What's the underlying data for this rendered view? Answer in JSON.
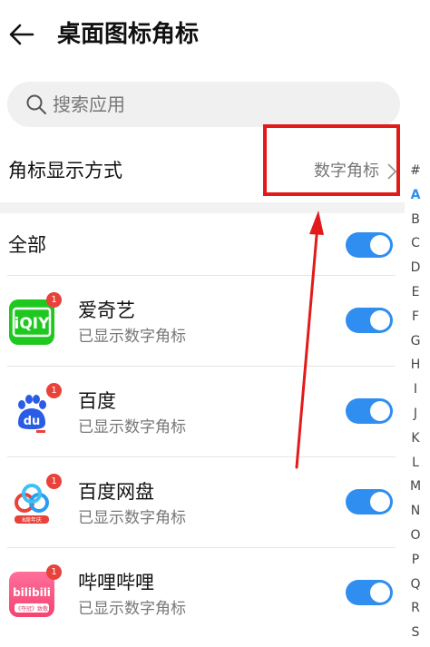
{
  "header": {
    "title": "桌面图标角标"
  },
  "search": {
    "placeholder": "搜索应用"
  },
  "badge_mode": {
    "label": "角标显示方式",
    "value": "数字角标"
  },
  "all": {
    "label": "全部",
    "enabled": true
  },
  "apps": [
    {
      "name": "爱奇艺",
      "status": "已显示数字角标",
      "badge": "1",
      "enabled": true,
      "icon": "iqiyi-icon"
    },
    {
      "name": "百度",
      "status": "已显示数字角标",
      "badge": "1",
      "enabled": true,
      "icon": "baidu-icon"
    },
    {
      "name": "百度网盘",
      "status": "已显示数字角标",
      "badge": "1",
      "enabled": true,
      "icon": "baidu-netdisk-icon"
    },
    {
      "name": "哔哩哔哩",
      "status": "已显示数字角标",
      "badge": "1",
      "enabled": true,
      "icon": "bilibili-icon"
    }
  ],
  "icon_text": {
    "iqiyi": "iQIY",
    "baidu": "du",
    "netdisk_caption": "8周年庆",
    "bilibili": "bilibili",
    "bilibili_caption": "《夺冠》致敬"
  },
  "index": [
    "#",
    "A",
    "B",
    "C",
    "D",
    "E",
    "F",
    "G",
    "H",
    "I",
    "J",
    "K",
    "L",
    "M",
    "N",
    "O",
    "P",
    "Q",
    "R",
    "S"
  ],
  "index_active": "A",
  "colors": {
    "accent": "#2f8ef0",
    "highlight": "#e21a1a",
    "badge": "#e8423a"
  }
}
